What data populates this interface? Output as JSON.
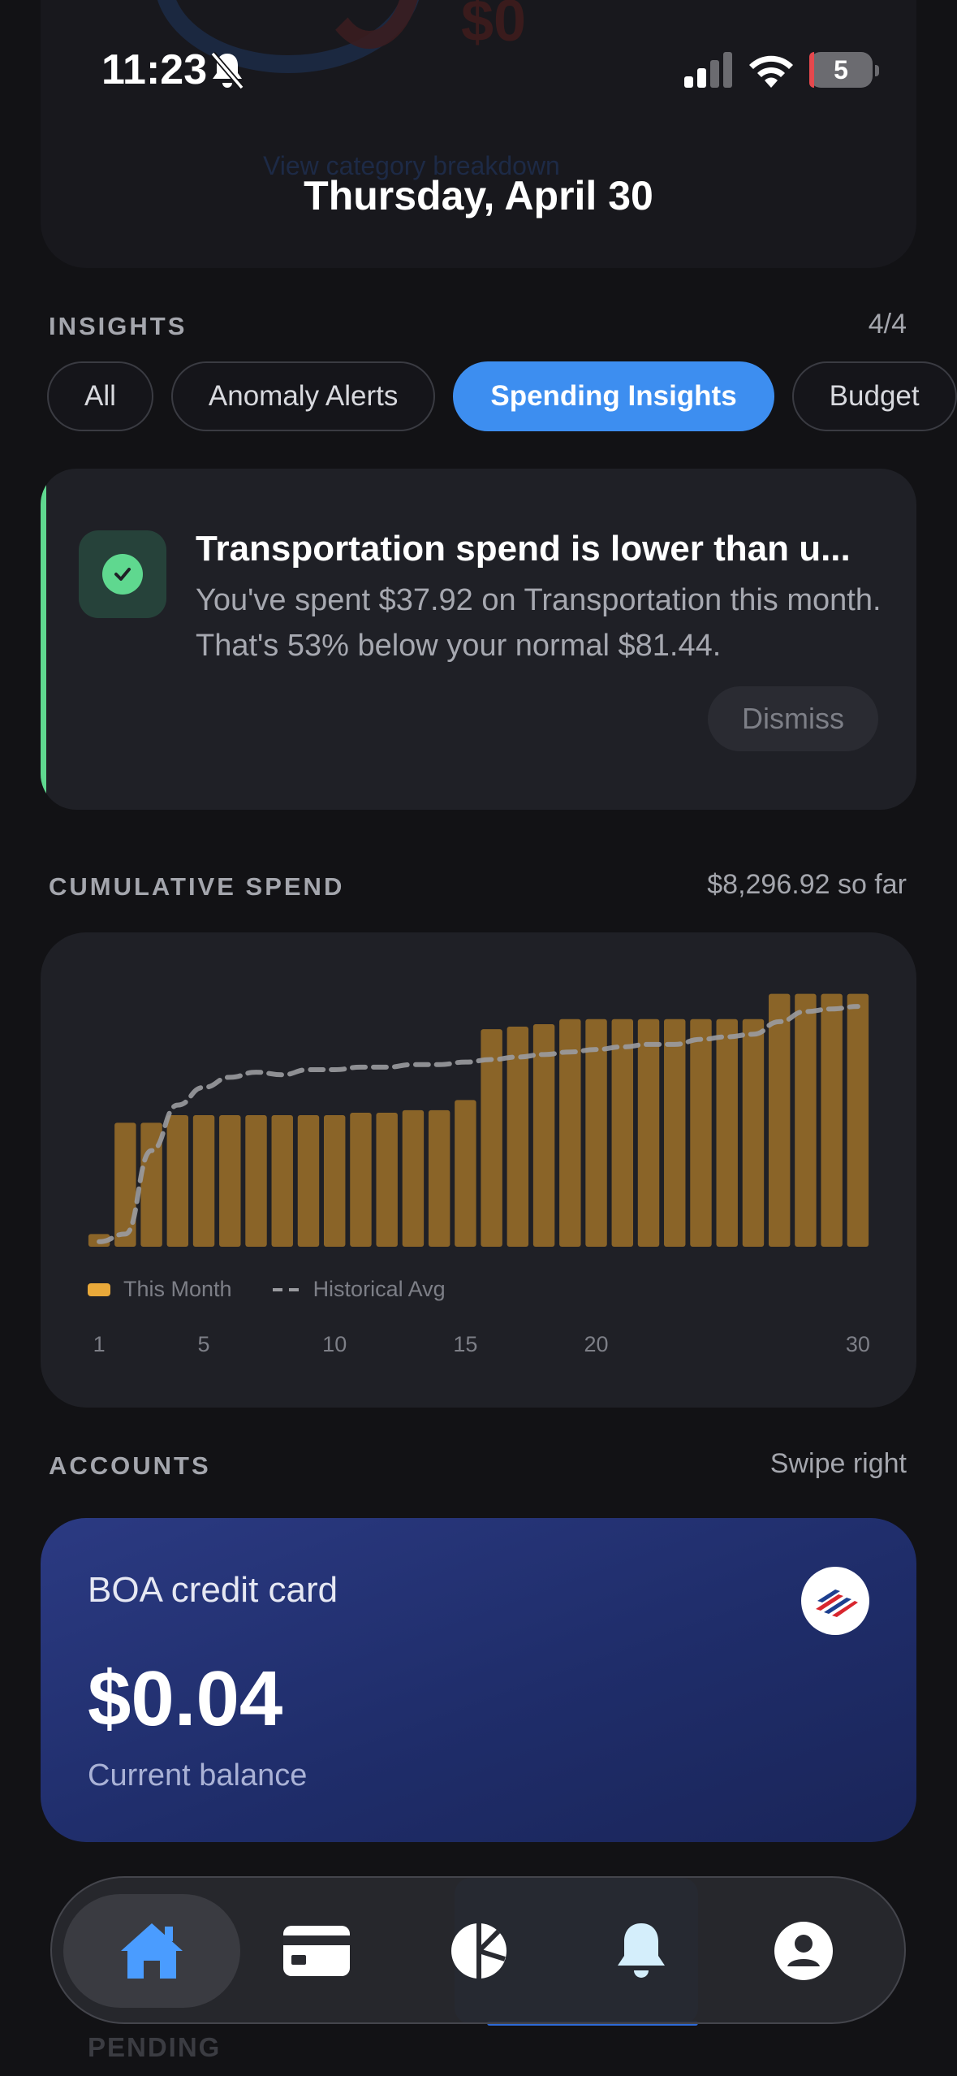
{
  "top_card": {
    "amount": "$0",
    "link": "View category breakdown"
  },
  "status": {
    "time": "11:23",
    "battery": "5"
  },
  "date_title": "Thursday, April 30",
  "insights": {
    "label": "INSIGHTS",
    "count": "4/4",
    "filters": [
      "All",
      "Anomaly Alerts",
      "Spending Insights",
      "Budget"
    ],
    "active_filter": "Spending Insights",
    "card": {
      "title": "Transportation spend is lower than u...",
      "body": "You've spent $37.92 on Transportation this month. That's 53% below your normal $81.44.",
      "dismiss": "Dismiss",
      "accent": "#5fd88f"
    }
  },
  "cumulative": {
    "label": "CUMULATIVE SPEND",
    "total": "$8,296.92 so far",
    "legend_this_month": "This Month",
    "legend_historical": "Historical Avg"
  },
  "chart_data": {
    "type": "bar",
    "x": [
      1,
      2,
      3,
      4,
      5,
      6,
      7,
      8,
      9,
      10,
      11,
      12,
      13,
      14,
      15,
      16,
      17,
      18,
      19,
      20,
      21,
      22,
      23,
      24,
      25,
      26,
      27,
      28,
      29,
      30
    ],
    "x_ticks": [
      "1",
      "5",
      "10",
      "15",
      "20",
      "30"
    ],
    "series": [
      {
        "name": "This Month",
        "type": "bar",
        "color": "#8a6428",
        "values": [
          0.05,
          0.49,
          0.49,
          0.52,
          0.52,
          0.52,
          0.52,
          0.52,
          0.52,
          0.52,
          0.53,
          0.53,
          0.54,
          0.54,
          0.58,
          0.86,
          0.87,
          0.88,
          0.9,
          0.9,
          0.9,
          0.9,
          0.9,
          0.9,
          0.9,
          0.9,
          1.0,
          1.0,
          1.0,
          1.0
        ]
      },
      {
        "name": "Historical Avg",
        "type": "line",
        "style": "dashed",
        "color": "#9a9ba0",
        "values": [
          0.02,
          0.05,
          0.38,
          0.56,
          0.63,
          0.67,
          0.69,
          0.68,
          0.7,
          0.7,
          0.71,
          0.71,
          0.72,
          0.72,
          0.73,
          0.74,
          0.75,
          0.76,
          0.77,
          0.78,
          0.79,
          0.8,
          0.8,
          0.82,
          0.83,
          0.84,
          0.89,
          0.93,
          0.94,
          0.95
        ]
      }
    ],
    "ylim": [
      0,
      1.05
    ],
    "grid": false,
    "legend": "bottom-left"
  },
  "accounts": {
    "label": "ACCOUNTS",
    "hint": "Swipe right",
    "card": {
      "name": "BOA credit card",
      "amount": "$0.04",
      "sub": "Current balance"
    }
  },
  "pending_label": "PENDING",
  "tabs": [
    "home-icon",
    "card-icon",
    "pie-chart-icon",
    "bell-icon",
    "profile-icon"
  ],
  "colors": {
    "accent_blue": "#3d8ef0",
    "bar": "#8a6428",
    "legend_bar": "#e9a93a"
  }
}
